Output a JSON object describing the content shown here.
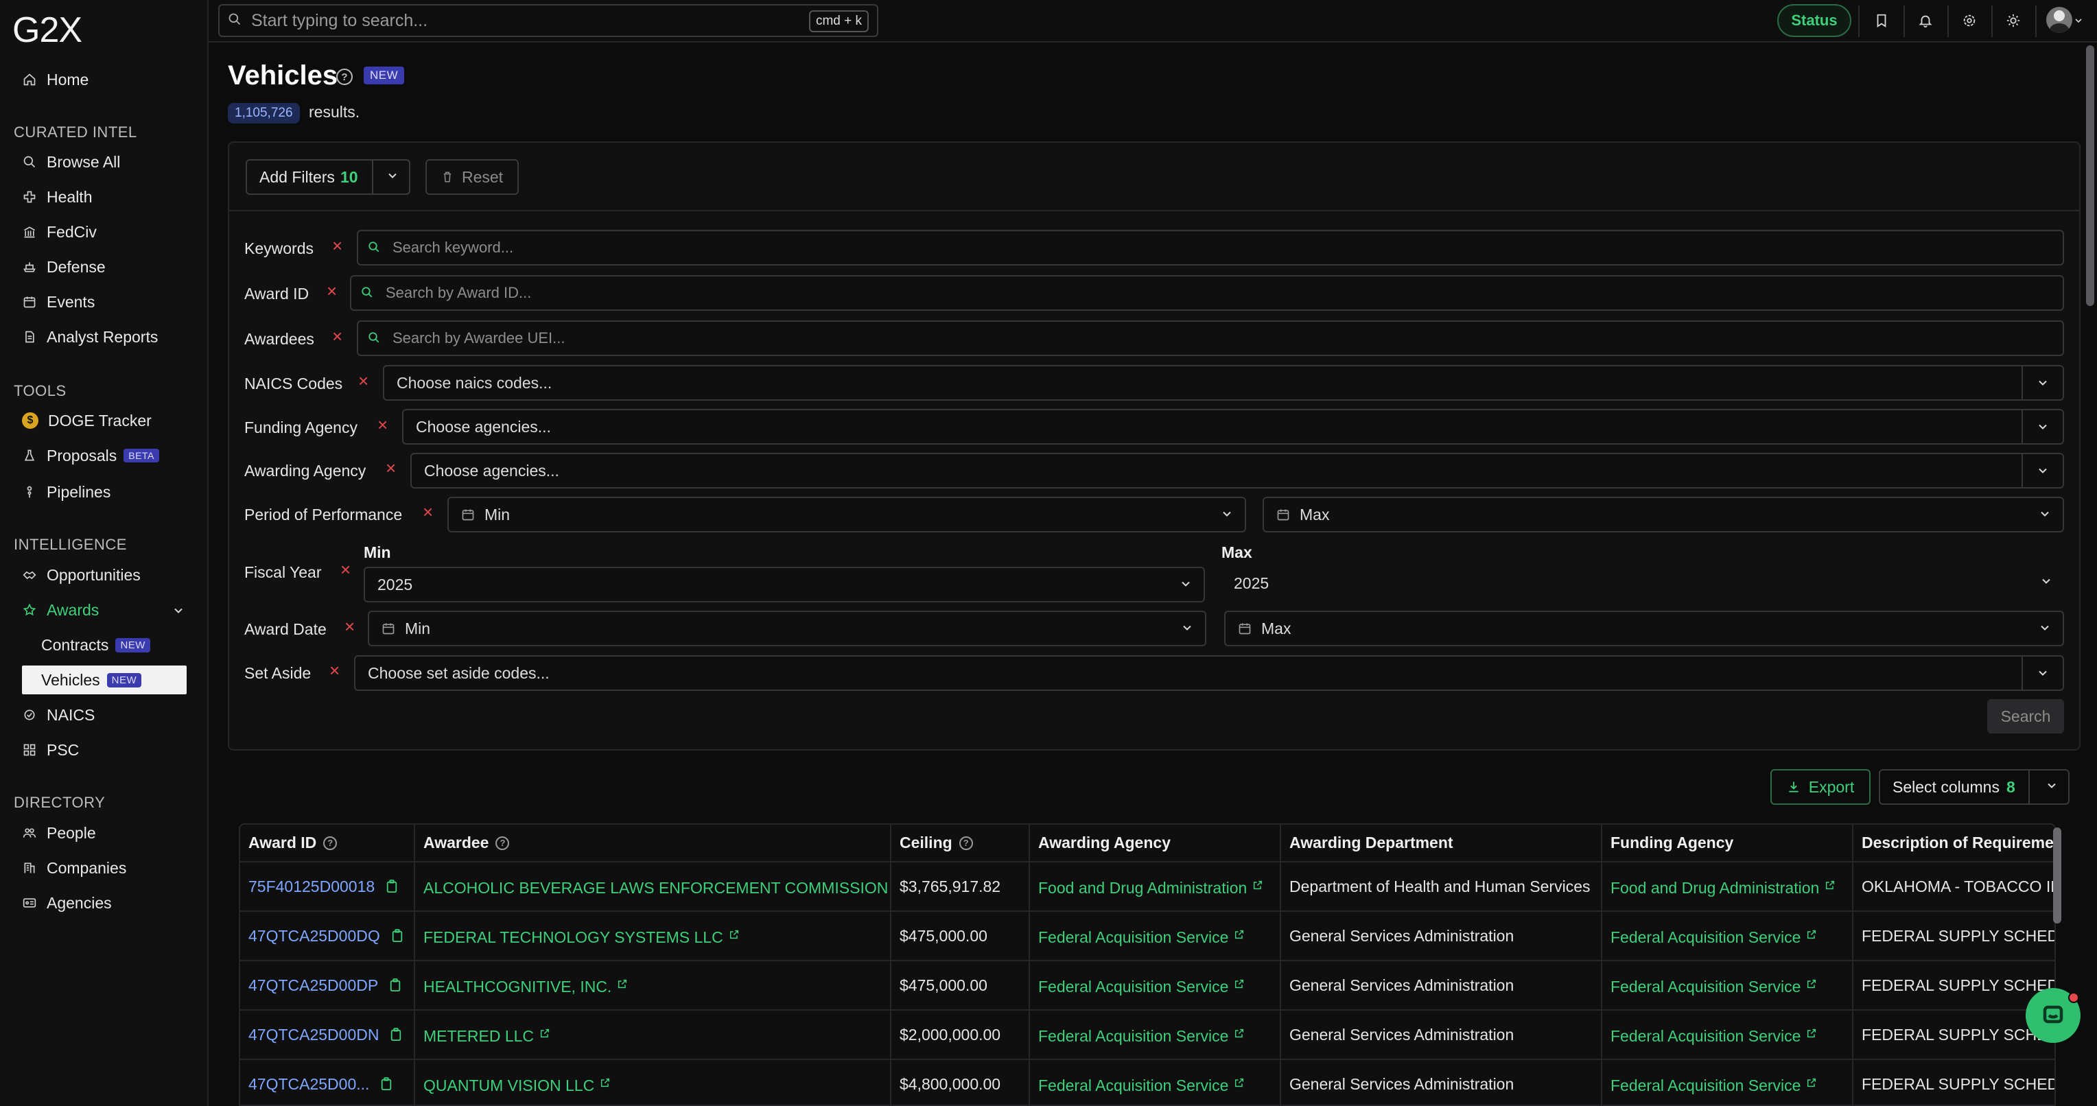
{
  "app": {
    "logo": "G2X"
  },
  "sidebar": {
    "home": "Home",
    "sections": {
      "curated": "CURATED INTEL",
      "tools": "TOOLS",
      "intelligence": "INTELLIGENCE",
      "directory": "DIRECTORY"
    },
    "curated_items": [
      "Browse All",
      "Health",
      "FedCiv",
      "Defense",
      "Events",
      "Analyst Reports"
    ],
    "tools_items": [
      "DOGE Tracker",
      "Proposals",
      "Pipelines"
    ],
    "proposals_badge": "BETA",
    "intel_items": [
      "Opportunities",
      "Awards"
    ],
    "awards_sub": [
      "Contracts",
      "Vehicles"
    ],
    "new_badge": "NEW",
    "intel_more": [
      "NAICS",
      "PSC"
    ],
    "directory_items": [
      "People",
      "Companies",
      "Agencies"
    ]
  },
  "topbar": {
    "search_placeholder": "Start typing to search...",
    "shortcut": "cmd + k",
    "status": "Status"
  },
  "page": {
    "title": "Vehicles",
    "help": "?",
    "badge": "NEW",
    "results_count": "1,105,726",
    "results_text": "results."
  },
  "filters": {
    "add_label": "Add Filters",
    "add_count": "10",
    "reset": "Reset",
    "remove_symbol": "×",
    "keywords": {
      "label": "Keywords",
      "placeholder": "Search keyword..."
    },
    "award_id": {
      "label": "Award ID",
      "placeholder": "Search by Award ID..."
    },
    "awardees": {
      "label": "Awardees",
      "placeholder": "Search by Awardee UEI..."
    },
    "naics": {
      "label": "NAICS Codes",
      "placeholder": "Choose naics codes..."
    },
    "funding": {
      "label": "Funding Agency",
      "placeholder": "Choose agencies..."
    },
    "awarding": {
      "label": "Awarding Agency",
      "placeholder": "Choose agencies..."
    },
    "pop": {
      "label": "Period of Performance",
      "min": "Min",
      "max": "Max"
    },
    "fiscal_year": {
      "label": "Fiscal Year",
      "min_label": "Min",
      "max_label": "Max",
      "min_value": "2025",
      "max_value": "2025"
    },
    "award_date": {
      "label": "Award Date",
      "min": "Min",
      "max": "Max"
    },
    "set_aside": {
      "label": "Set Aside",
      "placeholder": "Choose set aside codes..."
    },
    "search": "Search"
  },
  "table_controls": {
    "export": "Export",
    "select_columns": "Select columns",
    "columns_count": "8"
  },
  "table": {
    "headers": [
      "Award ID",
      "Awardee",
      "Ceiling",
      "Awarding Agency",
      "Awarding Department",
      "Funding Agency",
      "Description of Requireme"
    ],
    "rows": [
      [
        "75F40125D00018",
        "ALCOHOLIC BEVERAGE LAWS ENFORCEMENT COMMISSION",
        "$3,765,917.82",
        "Food and Drug Administration",
        "Department of Health and Human Services",
        "Food and Drug Administration",
        "OKLAHOMA - TOBACCO IN"
      ],
      [
        "47QTCA25D00DQ",
        "FEDERAL TECHNOLOGY SYSTEMS LLC",
        "$475,000.00",
        "Federal Acquisition Service",
        "General Services Administration",
        "Federal Acquisition Service",
        "FEDERAL SUPPLY SCHEDU"
      ],
      [
        "47QTCA25D00DP",
        "HEALTHCOGNITIVE, INC.",
        "$475,000.00",
        "Federal Acquisition Service",
        "General Services Administration",
        "Federal Acquisition Service",
        "FEDERAL SUPPLY SCHEDU"
      ],
      [
        "47QTCA25D00DN",
        "METERED LLC",
        "$2,000,000.00",
        "Federal Acquisition Service",
        "General Services Administration",
        "Federal Acquisition Service",
        "FEDERAL SUPPLY SCHEDU"
      ],
      [
        "47QTCA25D00...",
        "QUANTUM VISION LLC",
        "$4,800,000.00",
        "Federal Acquisition Service",
        "General Services Administration",
        "Federal Acquisition Service",
        "FEDERAL SUPPLY SCHEDU"
      ]
    ]
  },
  "colors": {
    "accent_green": "#3ed07a",
    "link_blue": "#7ea7ff",
    "danger": "#e5484d",
    "badge_purple": "#3b3bb0"
  }
}
